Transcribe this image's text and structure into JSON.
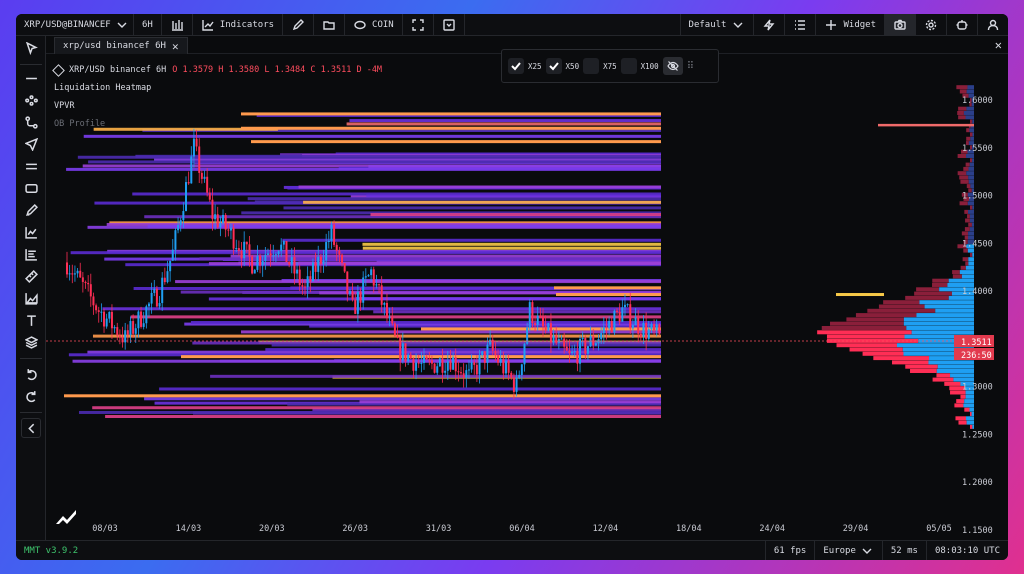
{
  "topbar": {
    "symbol": "XRP/USD@BINANCEF",
    "interval": "6H",
    "indicators": "Indicators",
    "coin": "COIN",
    "layout": "Default",
    "widget": "Widget"
  },
  "tab": {
    "label": "xrp/usd binancef 6H"
  },
  "legend": {
    "symbol": "XRP/USD binancef 6H",
    "ohlc": "O 1.3579 H 1.3580 L 1.3484 C 1.3511 D -4M",
    "indicators": [
      "Liquidation Heatmap",
      "VPVR",
      "OB Profile"
    ]
  },
  "filters": [
    {
      "label": "X25",
      "checked": true
    },
    {
      "label": "X50",
      "checked": true
    },
    {
      "label": "X75",
      "checked": false
    },
    {
      "label": "X100",
      "checked": false
    }
  ],
  "price_axis": {
    "ticks": [
      "1.6000",
      "1.5500",
      "1.5000",
      "1.4500",
      "1.4000",
      "1.3500",
      "1.3000",
      "1.2500",
      "1.2000",
      "1.1500"
    ],
    "current_price": "1.3511",
    "countdown": "236:50"
  },
  "time_axis": {
    "ticks": [
      "08/03",
      "14/03",
      "20/03",
      "26/03",
      "31/03",
      "06/04",
      "12/04",
      "18/04",
      "24/04",
      "29/04",
      "05/05"
    ]
  },
  "status": {
    "version": "MMT v3.9.2",
    "fps": "61 fps",
    "region": "Europe",
    "latency": "52 ms",
    "clock": "08:03:10 UTC"
  },
  "chart_data": {
    "type": "candlestick",
    "symbol": "XRP/USD",
    "interval": "6H",
    "ylim": [
      1.15,
      1.6
    ],
    "last": {
      "open": 1.3579,
      "high": 1.358,
      "low": 1.3484,
      "close": 1.3511
    },
    "x_ticks": [
      "08/03",
      "14/03",
      "20/03",
      "26/03",
      "31/03",
      "06/04",
      "12/04",
      "18/04",
      "24/04",
      "29/04",
      "05/05"
    ],
    "y_ticks": [
      1.6,
      1.55,
      1.5,
      1.45,
      1.4,
      1.35,
      1.3,
      1.25,
      1.2,
      1.15
    ],
    "colors": {
      "up": "#1f9ff2",
      "down": "#ff2e55",
      "heat_low": "#6a2fd8",
      "heat_high": "#ffb347",
      "vp_buy": "#1f9ff2",
      "vp_sell": "#ff2e55"
    }
  }
}
